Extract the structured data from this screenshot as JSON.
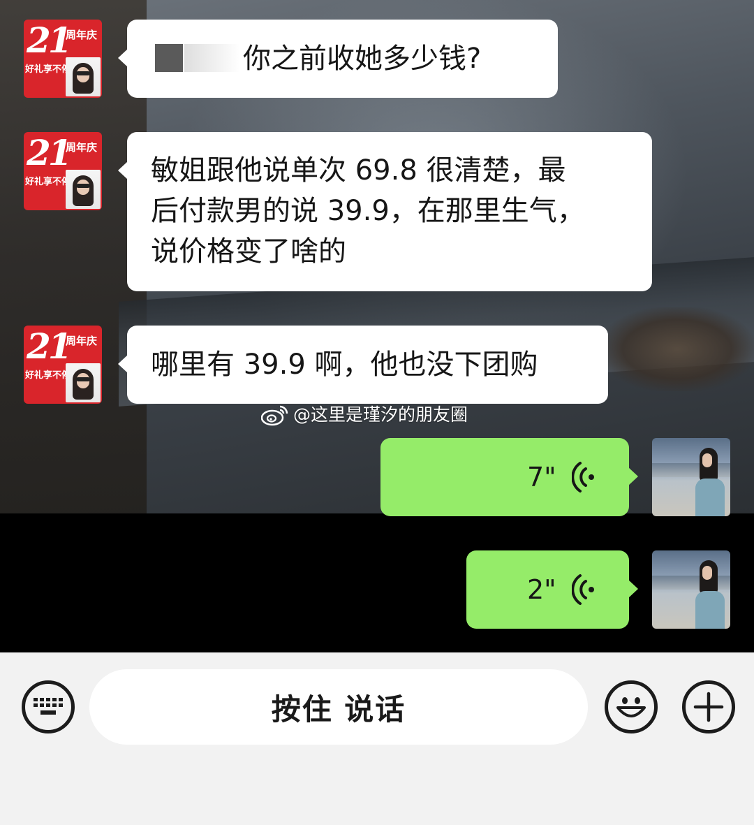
{
  "chat": {
    "messages": [
      {
        "side": "left",
        "type": "text",
        "text": "你之前收她多少钱?",
        "redacted_prefix": true
      },
      {
        "side": "left",
        "type": "text",
        "lines": [
          "敏姐跟他说单次 69.8 很清楚，最",
          "后付款男的说 39.9，在那里生气，",
          "说价格变了啥的"
        ]
      },
      {
        "side": "left",
        "type": "text",
        "text": "哪里有 39.9 啊，他也没下团购"
      },
      {
        "side": "right",
        "type": "voice",
        "duration": "7\""
      },
      {
        "side": "right",
        "type": "voice",
        "duration": "2\""
      }
    ],
    "left_avatar": {
      "number": "21",
      "anniversary": "周年庆",
      "slogan": "好礼享不停"
    }
  },
  "watermark": {
    "text": "@这里是瑾汐的朋友圈",
    "icon": "weibo-icon"
  },
  "input_bar": {
    "hold_to_talk_label": "按住 说话",
    "keyboard_icon": "keyboard-icon",
    "emoji_icon": "smiley-icon",
    "more_icon": "plus-icon"
  },
  "colors": {
    "sent_bubble": "#95ec69",
    "received_bubble": "#ffffff",
    "input_bar_bg": "#f2f2f2",
    "avatar_red": "#d9252b"
  }
}
